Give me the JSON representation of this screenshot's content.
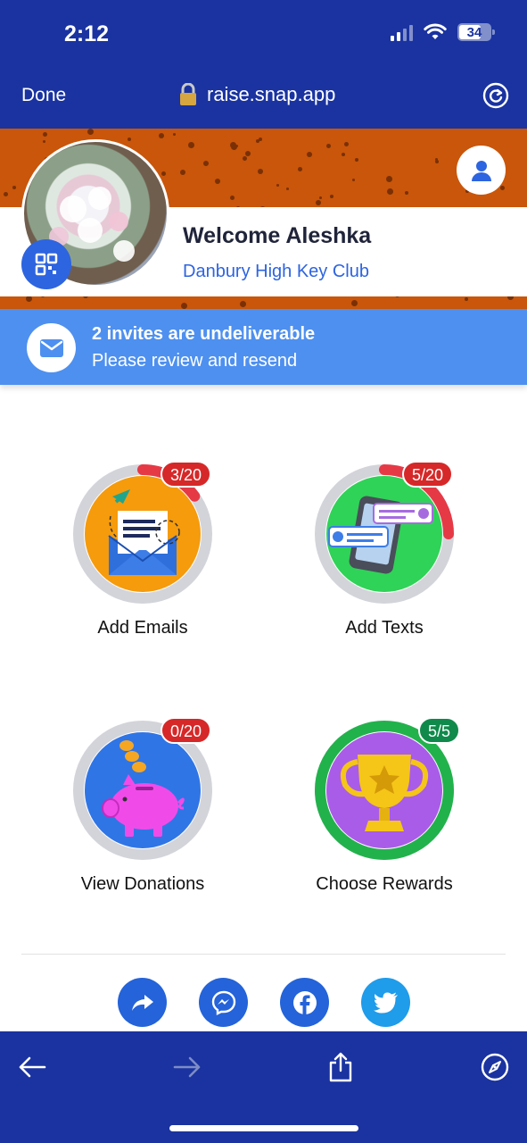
{
  "status": {
    "time": "2:12",
    "battery": "34"
  },
  "browser": {
    "done_label": "Done",
    "url": "raise.snap.app"
  },
  "profile": {
    "welcome": "Welcome Aleshka",
    "org": "Danbury High Key Club"
  },
  "notice": {
    "title": "2 invites are undeliverable",
    "subtitle": "Please review and resend"
  },
  "tiles": [
    {
      "label": "Add Emails",
      "badge": "3/20",
      "progress": 0.15,
      "badge_color": "#d62828"
    },
    {
      "label": "Add Texts",
      "badge": "5/20",
      "progress": 0.25,
      "badge_color": "#d62828"
    },
    {
      "label": "View Donations",
      "badge": "0/20",
      "progress": 0.0,
      "badge_color": "#d62828"
    },
    {
      "label": "Choose Rewards",
      "badge": "5/5",
      "progress": 1.0,
      "badge_color": "#0f8a4a"
    }
  ],
  "colors": {
    "brand_navy": "#1a33a0",
    "banner_orange": "#c9560a",
    "notice_blue": "#4e90ef",
    "link_blue": "#2d64e0",
    "progress_red": "#e63946",
    "complete_green": "#22b24c"
  },
  "share": [
    "share-arrow-icon",
    "messenger-icon",
    "facebook-icon",
    "twitter-icon"
  ]
}
